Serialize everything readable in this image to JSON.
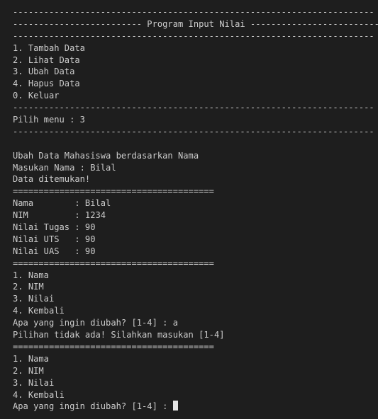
{
  "terminal": {
    "lines": [
      "----------------------------------------------------------------------",
      "------------------------- Program Input Nilai -------------------------",
      "----------------------------------------------------------------------",
      "1. Tambah Data",
      "2. Lihat Data",
      "3. Ubah Data",
      "4. Hapus Data",
      "0. Keluar",
      "----------------------------------------------------------------------",
      "Pilih menu : 3",
      "----------------------------------------------------------------------",
      "",
      "Ubah Data Mahasiswa berdasarkan Nama",
      "Masukan Nama : Bilal",
      "Data ditemukan!",
      "=======================================",
      "Nama        : Bilal",
      "NIM         : 1234",
      "Nilai Tugas : 90",
      "Nilai UTS   : 90",
      "Nilai UAS   : 90",
      "=======================================",
      "1. Nama",
      "2. NIM",
      "3. Nilai",
      "4. Kembali",
      "Apa yang ingin diubah? [1-4] : a",
      "Pilihan tidak ada! Silahkan masukan [1-4]",
      "=======================================",
      "1. Nama",
      "2. NIM",
      "3. Nilai",
      "4. Kembali"
    ],
    "prompt": "Apa yang ingin diubah? [1-4] : "
  }
}
